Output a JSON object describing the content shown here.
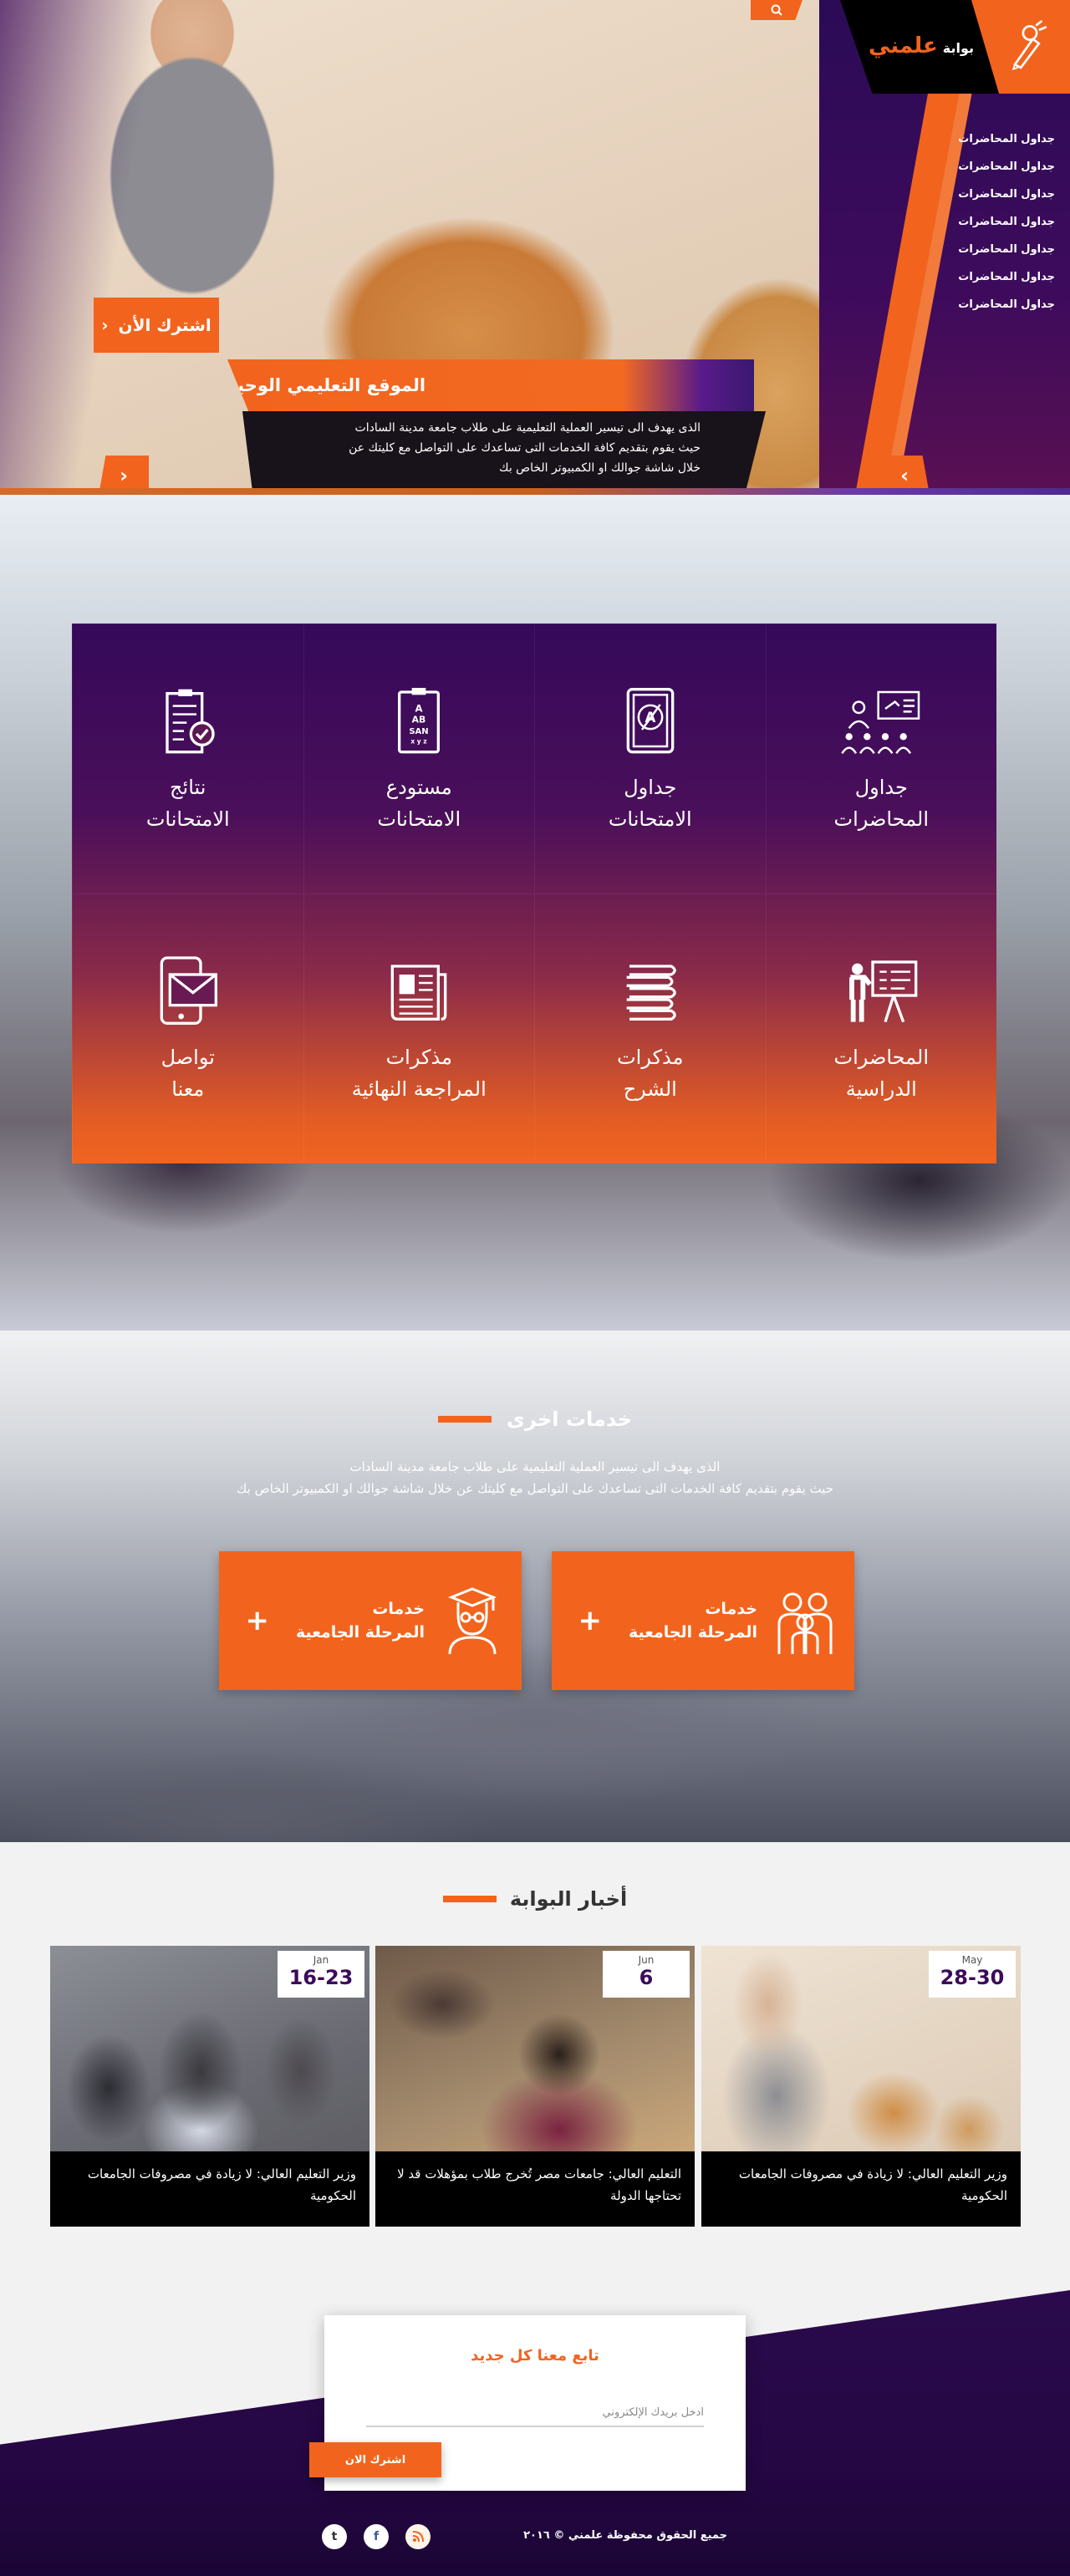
{
  "header": {
    "logo_prefix": "بوابة",
    "logo_brand": "علمني",
    "menu": [
      "جداول المحاضرات",
      "جداول المحاضرات",
      "جداول المحاضرات",
      "جداول المحاضرات",
      "جداول المحاضرات",
      "جداول المحاضرات",
      "جداول المحاضرات"
    ]
  },
  "hero": {
    "subscribe_label": "اشترك الأن",
    "caption_title": "الموقع التعليمي الوحيد",
    "caption_lines": [
      "الذى يهدف الى تيسير العملية التعليمية على طلاب جامعة مدينة السادات",
      "حيث يقوم بتقديم كافة الخدمات التى تساعدك على التواصل مع كليتك عن",
      "خلال شاشة جوالك او الكمبيوتر الخاص بك"
    ]
  },
  "services": [
    {
      "icon": "lecture-schedule-icon",
      "l1": "جداول",
      "l2": "المحاضرات"
    },
    {
      "icon": "exam-schedule-icon",
      "l1": "جداول",
      "l2": "الامتحانات"
    },
    {
      "icon": "exam-bank-icon",
      "l1": "مستودع",
      "l2": "الامتحانات"
    },
    {
      "icon": "exam-results-icon",
      "l1": "نتائج",
      "l2": "الامتحانات"
    },
    {
      "icon": "lectures-icon",
      "l1": "المحاضرات",
      "l2": "الدراسية"
    },
    {
      "icon": "notes-icon",
      "l1": "مذكرات",
      "l2": "الشرح"
    },
    {
      "icon": "review-notes-icon",
      "l1": "مذكرات",
      "l2": "المراجعة النهائية"
    },
    {
      "icon": "contact-icon",
      "l1": "تواصل",
      "l2": "معنا"
    }
  ],
  "other_services": {
    "title": "خدمات اخرى",
    "desc_line1": "الذى يهدف الى تيسير العملية التعليمية على طلاب جامعة مدينة السادات",
    "desc_line2": "حيث يقوم بتقديم كافة الخدمات التى تساعدك على التواصل مع كليتك عن خلال شاشة جوالك او الكمبيوتر الخاص بك",
    "cards": [
      {
        "l1": "خدمات",
        "l2": "المرحلة الجامعية",
        "icon": "students-group-icon"
      },
      {
        "l1": "خدمات",
        "l2": "المرحلة الجامعية",
        "icon": "graduate-icon"
      }
    ]
  },
  "news": {
    "title": "أخبار البوابة",
    "items": [
      {
        "month": "May",
        "day": "28-30",
        "text": "وزير التعليم العالي: لا زيادة في مصروفات الجامعات الحكومية"
      },
      {
        "month": "Jun",
        "day": "6",
        "text": "التعليم العالي: جامعات مصر تُخرج طلاب بمؤهلات قد لا تحتاجها الدولة"
      },
      {
        "month": "Jan",
        "day": "16-23",
        "text": "وزير التعليم العالي: لا زيادة في مصروفات الجامعات الحكومية"
      }
    ]
  },
  "footer": {
    "newsletter_title": "تابع معنا كل جديد",
    "email_placeholder": "ادخل بريدك الإلكتروني",
    "subscribe_label": "اشترك الان",
    "copyright": "جميع الحقوق محفوظة علمني © ٢٠١٦",
    "socials": [
      "t",
      "f",
      "rss"
    ]
  },
  "colors": {
    "accent": "#f2641d",
    "purple": "#3c0a5a"
  }
}
